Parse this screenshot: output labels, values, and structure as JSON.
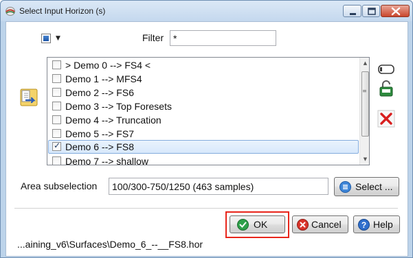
{
  "window": {
    "title": "Select Input Horizon (s)",
    "accent": "#3a77c8"
  },
  "select_all": {
    "icon": "checkbox-square-icon",
    "dropdown_icon": "chevron-down-icon"
  },
  "filter": {
    "label": "Filter",
    "value": "*"
  },
  "horizon_list": {
    "items": [
      {
        "label": "> Demo 0 --> FS4 <",
        "checked": false,
        "selected": false
      },
      {
        "label": "Demo 1 --> MFS4",
        "checked": false,
        "selected": false
      },
      {
        "label": "Demo 2 --> FS6",
        "checked": false,
        "selected": false
      },
      {
        "label": "Demo 3  --> Top Foresets",
        "checked": false,
        "selected": false
      },
      {
        "label": "Demo 4 --> Truncation",
        "checked": false,
        "selected": false
      },
      {
        "label": "Demo 5 --> FS7",
        "checked": false,
        "selected": false
      },
      {
        "label": "Demo 6 --> FS8",
        "checked": true,
        "selected": true
      },
      {
        "label": "Demo 7 --> shallow",
        "checked": false,
        "selected": false
      }
    ]
  },
  "side_icons": {
    "left": "import-horizon-icon",
    "right": [
      "display-icon",
      "lock-save-icon",
      "delete-x-icon"
    ]
  },
  "area_subselection": {
    "label": "Area subselection",
    "value": "100/300-750/1250 (463 samples)",
    "select_button": "Select ..."
  },
  "buttons": {
    "ok": "OK",
    "cancel": "Cancel",
    "help": "Help"
  },
  "status": {
    "path": "...aining_v6\\Surfaces\\Demo_6_--__FS8.hor"
  }
}
